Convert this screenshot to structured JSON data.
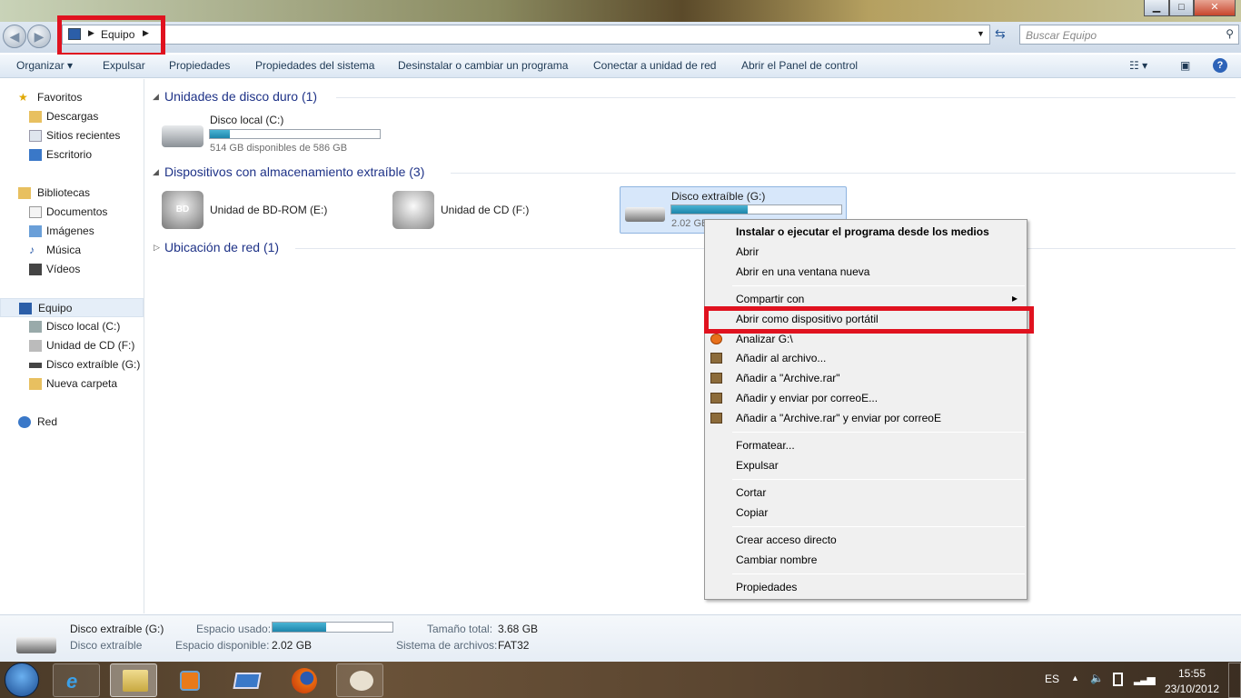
{
  "window": {
    "minimize": "▁",
    "maximize": "□",
    "close": "✕"
  },
  "address": {
    "crumb": "Equipo",
    "search_placeholder": "Buscar Equipo"
  },
  "toolbar": {
    "items": [
      "Organizar ▾",
      "Expulsar",
      "Propiedades",
      "Propiedades del sistema",
      "Desinstalar o cambiar un programa",
      "Conectar a unidad de red",
      "Abrir el Panel de control"
    ],
    "help": "?"
  },
  "sidebar": {
    "favoritos": "Favoritos",
    "fav_items": [
      "Descargas",
      "Sitios recientes",
      "Escritorio"
    ],
    "bibliotecas": "Bibliotecas",
    "lib_items": [
      "Documentos",
      "Imágenes",
      "Música",
      "Vídeos"
    ],
    "equipo": "Equipo",
    "eq_items": [
      "Disco local (C:)",
      "Unidad de CD (F:)",
      "Disco extraíble (G:)",
      "Nueva carpeta"
    ],
    "red": "Red"
  },
  "main": {
    "hdd_group": "Unidades de disco duro (1)",
    "c_drive": {
      "name": "Disco local (C:)",
      "free": "514 GB disponibles de 586 GB",
      "used_fraction": 0.12
    },
    "removable_group": "Dispositivos con almacenamiento extraíble (3)",
    "e_drive": {
      "name": "Unidad de BD-ROM (E:)",
      "badge": "BD"
    },
    "f_drive": {
      "name": "Unidad de CD (F:)"
    },
    "g_drive": {
      "name": "Disco extraíble (G:)",
      "free": "2.02 GB",
      "used_fraction": 0.45
    },
    "network_group": "Ubicación de red (1)"
  },
  "menu": {
    "items": [
      "Instalar o ejecutar el programa desde los medios",
      "Abrir",
      "Abrir en una ventana nueva",
      "Compartir con",
      "Abrir como dispositivo portátil",
      "Analizar G:\\",
      "Añadir al archivo...",
      "Añadir a \"Archive.rar\"",
      "Añadir y enviar por correoE...",
      "Añadir a \"Archive.rar\" y enviar por correoE",
      "Formatear...",
      "Expulsar",
      "Cortar",
      "Copiar",
      "Crear acceso directo",
      "Cambiar nombre",
      "Propiedades"
    ],
    "submenu_arrow": "▸"
  },
  "details": {
    "name": "Disco extraíble (G:)",
    "type": "Disco extraíble",
    "used_label": "Espacio usado:",
    "free_label": "Espacio disponible:",
    "free_value": "2.02 GB",
    "total_label": "Tamaño total:",
    "total_value": "3.68 GB",
    "fs_label": "Sistema de archivos:",
    "fs_value": "FAT32",
    "used_fraction": 0.45
  },
  "tray": {
    "lang": "ES",
    "time": "15:55",
    "date": "23/10/2012"
  }
}
